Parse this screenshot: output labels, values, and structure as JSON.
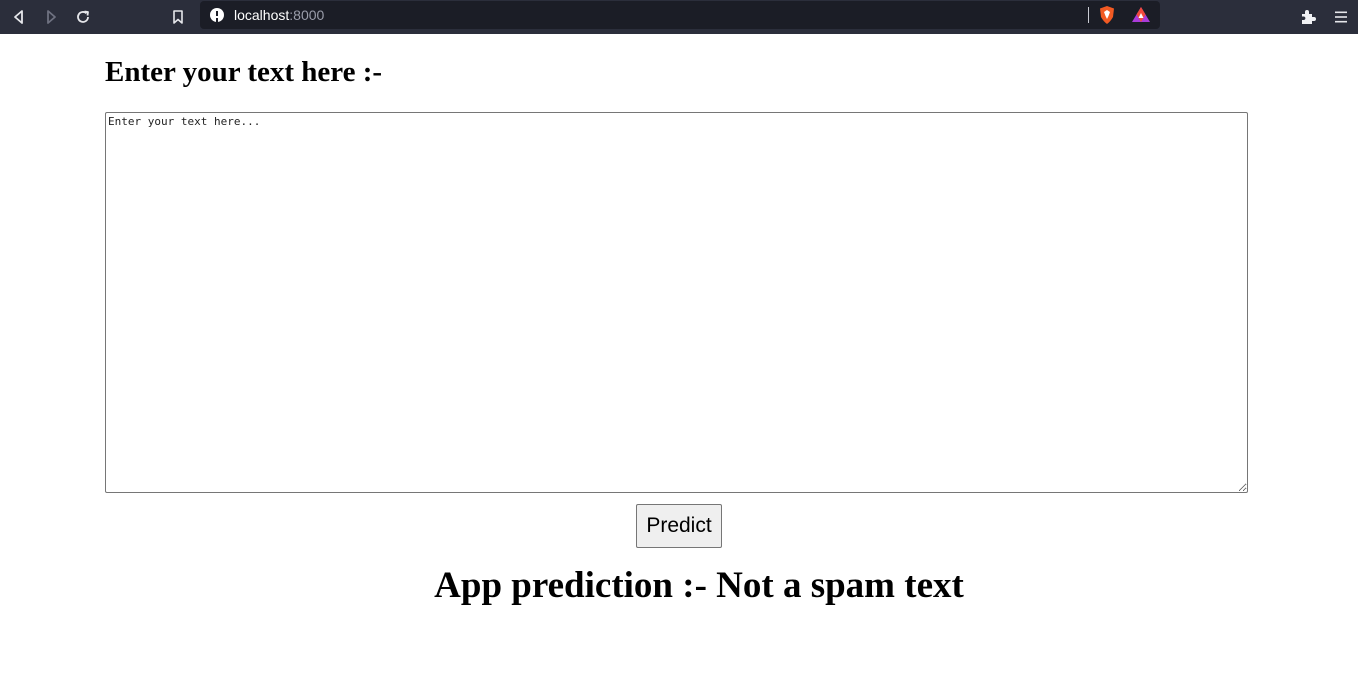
{
  "browser": {
    "url_host": "localhost",
    "url_port": ":8000",
    "icons": [
      "back-icon",
      "forward-icon",
      "reload-icon",
      "bookmark-icon",
      "info-icon",
      "brave-shield-icon",
      "brave-rewards-icon",
      "extensions-icon",
      "menu-icon"
    ]
  },
  "form": {
    "heading": "Enter your text here :-",
    "textarea_placeholder": "Enter your text here...",
    "submit_label": "Predict"
  },
  "result": {
    "text": "App prediction :- Not a spam text"
  }
}
